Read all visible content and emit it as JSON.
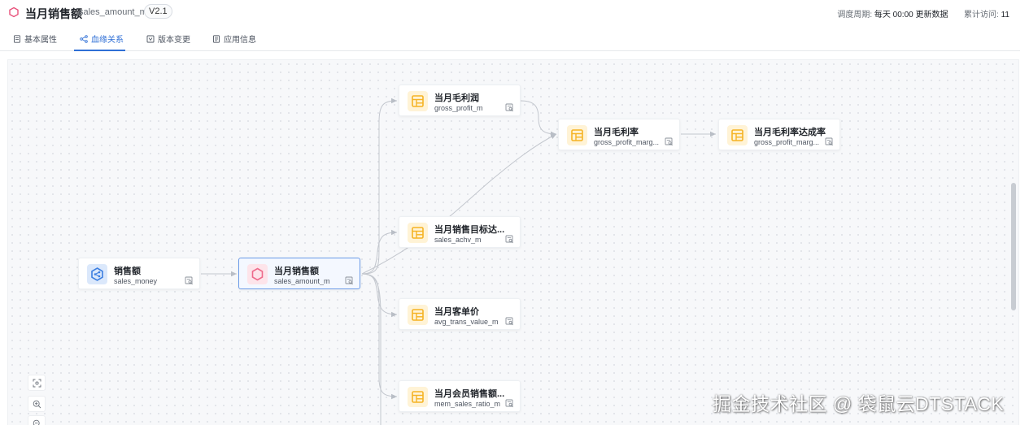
{
  "header": {
    "title": "当月销售额",
    "code": "sales_amount_m",
    "version": "V2.1",
    "schedule_label": "调度周期:",
    "schedule_value": "每天 00:00 更新数据",
    "visits_label": "累计访问:",
    "visits_value": "11",
    "icon": "hexagon-icon",
    "accent": "#e8507a"
  },
  "tabs": [
    {
      "label": "基本属性",
      "icon": "document-icon",
      "active": false
    },
    {
      "label": "血缘关系",
      "icon": "lineage-icon",
      "active": true
    },
    {
      "label": "版本变更",
      "icon": "version-icon",
      "active": false
    },
    {
      "label": "应用信息",
      "icon": "list-icon",
      "active": false
    }
  ],
  "nodes": {
    "sales_money": {
      "title": "销售额",
      "code": "sales_money",
      "icon": "atomic-metric-icon"
    },
    "sales_amount_m": {
      "title": "当月销售额",
      "code": "sales_amount_m",
      "icon": "derived-metric-icon",
      "selected": true
    },
    "gross_profit_m": {
      "title": "当月毛利润",
      "code": "gross_profit_m",
      "icon": "composite-metric-icon"
    },
    "gross_profit_marg": {
      "title": "当月毛利率",
      "code": "gross_profit_marg...",
      "icon": "composite-metric-icon"
    },
    "gross_profit_marg_achv": {
      "title": "当月毛利率达成率",
      "code": "gross_profit_marg...",
      "icon": "composite-metric-icon"
    },
    "sales_achv_m": {
      "title": "当月销售目标达...",
      "code": "sales_achv_m",
      "icon": "composite-metric-icon"
    },
    "avg_trans_value_m": {
      "title": "当月客单价",
      "code": "avg_trans_value_m",
      "icon": "composite-metric-icon"
    },
    "mem_sales_ratio_m": {
      "title": "当月会员销售额...",
      "code": "mem_sales_ratio_m",
      "icon": "composite-metric-icon"
    }
  },
  "colors": {
    "primary": "#2f6fd6",
    "yellow_icon": "#f5b324",
    "blue_icon": "#3c7ee0",
    "pink_icon": "#ee6a8b"
  },
  "watermark": "掘金技术社区 @ 袋鼠云DTSTACK"
}
